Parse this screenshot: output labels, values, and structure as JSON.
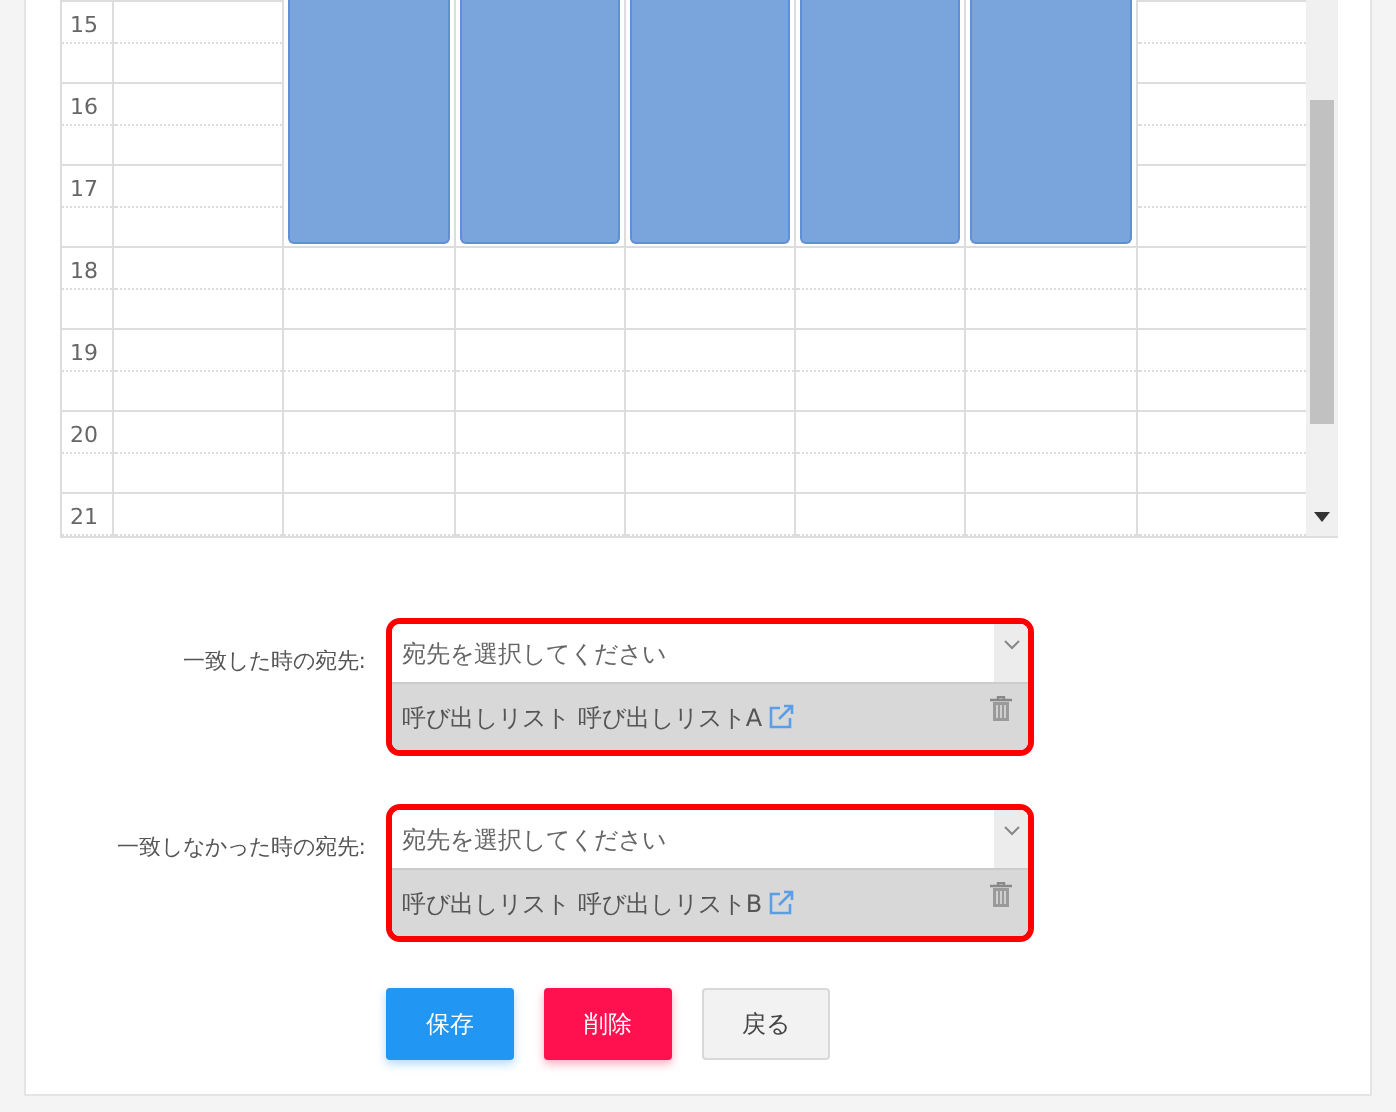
{
  "calendar": {
    "hours": [
      "15",
      "16",
      "17",
      "18",
      "19",
      "20",
      "21"
    ],
    "day_columns": [
      {
        "has_event": false
      },
      {
        "has_event": true
      },
      {
        "has_event": true
      },
      {
        "has_event": true
      },
      {
        "has_event": true
      },
      {
        "has_event": true
      },
      {
        "has_event": false
      }
    ]
  },
  "destinations": [
    {
      "label": "一致した時の宛先:",
      "placeholder": "宛先を選択してください",
      "highlighted": true,
      "item": {
        "text": "呼び出しリスト 呼び出しリストA"
      }
    },
    {
      "label": "一致しなかった時の宛先:",
      "placeholder": "宛先を選択してください",
      "highlighted": true,
      "item": {
        "text": "呼び出しリスト 呼び出しリストB"
      }
    }
  ],
  "buttons": [
    {
      "label": "保存",
      "kind": "primary"
    },
    {
      "label": "削除",
      "kind": "danger"
    },
    {
      "label": "戻る",
      "kind": "default"
    }
  ]
}
